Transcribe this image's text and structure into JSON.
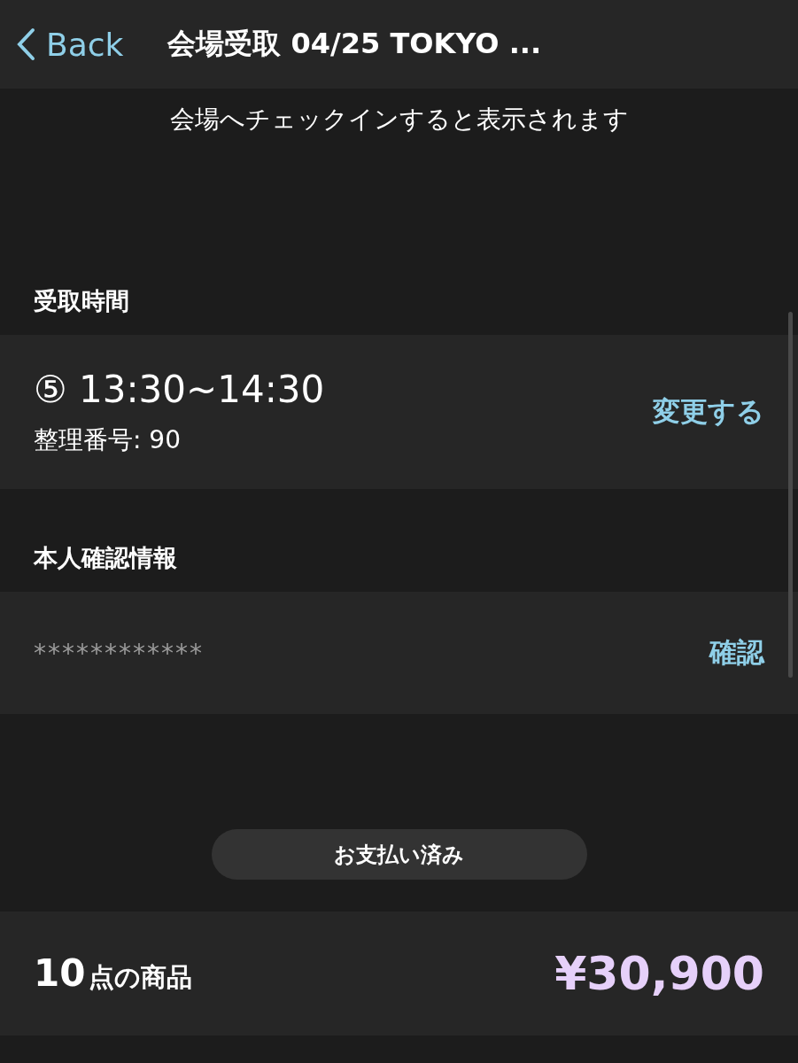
{
  "header": {
    "back_label": "Back",
    "title": "会場受取 04/25 TOKYO ..."
  },
  "notice": "会場へチェックインすると表示されます",
  "pickup": {
    "heading": "受取時間",
    "slot": "⑤ 13:30~14:30",
    "number": "整理番号: 90",
    "action": "変更する"
  },
  "identity": {
    "heading": "本人確認情報",
    "masked": "************",
    "action": "確認"
  },
  "status_button": "お支払い済み",
  "summary": {
    "count": "10",
    "count_label": "点の商品",
    "price": "¥30,900"
  }
}
